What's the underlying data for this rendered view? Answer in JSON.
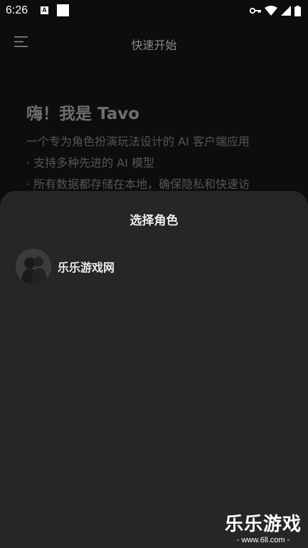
{
  "status_bar": {
    "time": "6:26",
    "a_icon_text": "A",
    "icons": [
      "key-icon",
      "wifi-icon",
      "signal-icon",
      "battery-icon"
    ]
  },
  "app_bar": {
    "title": "快速开始",
    "menu_icon": "menu-icon"
  },
  "intro": {
    "heading": "嗨！我是 Tavo",
    "lines": [
      "一个专为角色扮演玩法设计的 AI 客户端应用",
      "· 支持多种先进的 AI 模型",
      "· 所有数据都存储在本地，确保隐私和快速访"
    ]
  },
  "sheet": {
    "title": "选择角色",
    "characters": [
      {
        "name": "乐乐游戏网",
        "avatar": "avatar-silhouette"
      }
    ]
  },
  "watermark": {
    "big": "乐乐游戏",
    "small": "- www.6ll.com -"
  },
  "colors": {
    "background": "#0d0d0d",
    "sheet": "#262626",
    "text_primary": "#ececec",
    "text_dim": "#555555"
  }
}
